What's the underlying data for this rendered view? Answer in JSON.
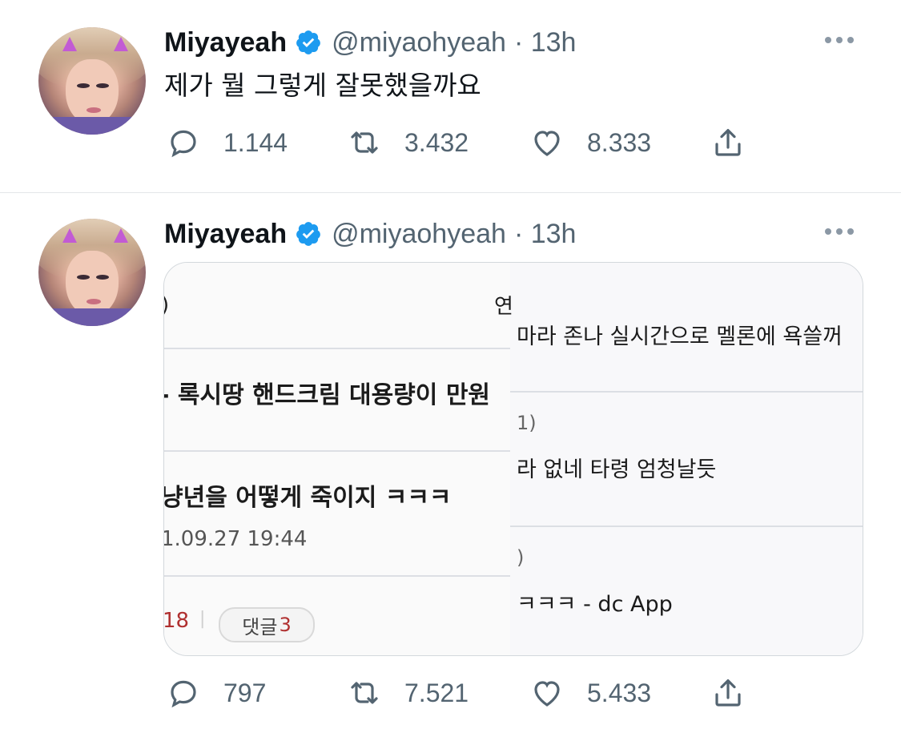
{
  "tweets": [
    {
      "author": "Miyayeah",
      "handle": "@miyaohyeah",
      "time": "· 13h",
      "text": "제가 뭘 그렇게 잘못했을까요",
      "replies": "1.144",
      "retweets": "3.432",
      "likes": "8.333"
    },
    {
      "author": "Miyayeah",
      "handle": "@miyaohyeah",
      "time": "· 13h",
      "replies": "797",
      "retweets": "7.521",
      "likes": "5.433",
      "media": {
        "left": {
          "line_top": ")",
          "line1": "- 록시땅 핸드크림 대용량이 만원",
          "line2": "냥년을 어떻게 죽이지 ㅋㅋㅋ",
          "date": "1.09.27 19:44",
          "count": "18",
          "comment_label": "댓글",
          "comment_count": "3"
        },
        "right": {
          "line_top": "연",
          "line1": "마라 존나 실시간으로 멜론에 욕쓸꺼",
          "line2": "1)",
          "line3": "라 없네 타령 엄청날듯",
          "line4": ")",
          "line5": "ㅋㅋㅋ - dc App"
        }
      }
    }
  ],
  "icons": [
    "reply-icon",
    "retweet-icon",
    "like-icon",
    "share-icon",
    "verified-badge-icon",
    "more-icon"
  ],
  "colors": {
    "verified": "#1d9bf0",
    "secondary_text": "#536471"
  }
}
